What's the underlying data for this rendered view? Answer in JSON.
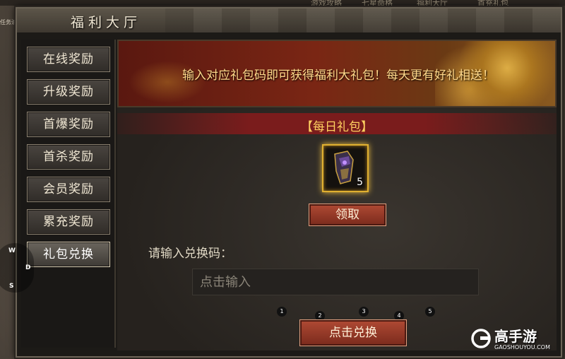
{
  "top_strip": {
    "left_text": "游戏攻略",
    "mid_text": "七星命格",
    "right_text": "福利大厅",
    "far_text": "首充礼包"
  },
  "task_label": "任务追踪",
  "window": {
    "title": "福利大厅"
  },
  "sidebar": {
    "items": [
      {
        "label": "在线奖励"
      },
      {
        "label": "升级奖励"
      },
      {
        "label": "首爆奖励"
      },
      {
        "label": "首杀奖励"
      },
      {
        "label": "会员奖励"
      },
      {
        "label": "累充奖励"
      },
      {
        "label": "礼包兑换"
      }
    ],
    "active_index": 6
  },
  "banner": {
    "message": "输入对应礼包码即可获得福利大礼包！每天更有好礼相送！"
  },
  "daily_pack": {
    "title": "【每日礼包】",
    "item_count": "5",
    "claim_label": "领取"
  },
  "redeem": {
    "label": "请输入兑换码：",
    "placeholder": "点击输入",
    "button_label": "点击兑换",
    "steps": [
      "1",
      "2",
      "3",
      "4",
      "5"
    ]
  },
  "dpad": {
    "up": "W",
    "right": "D",
    "down": "S"
  },
  "watermark": {
    "name": "高手游",
    "url": "GAOSHOUYOU.COM"
  },
  "colors": {
    "accent_gold": "#ffd060",
    "button_red": "#b04a34",
    "slot_border": "#e0b030"
  }
}
